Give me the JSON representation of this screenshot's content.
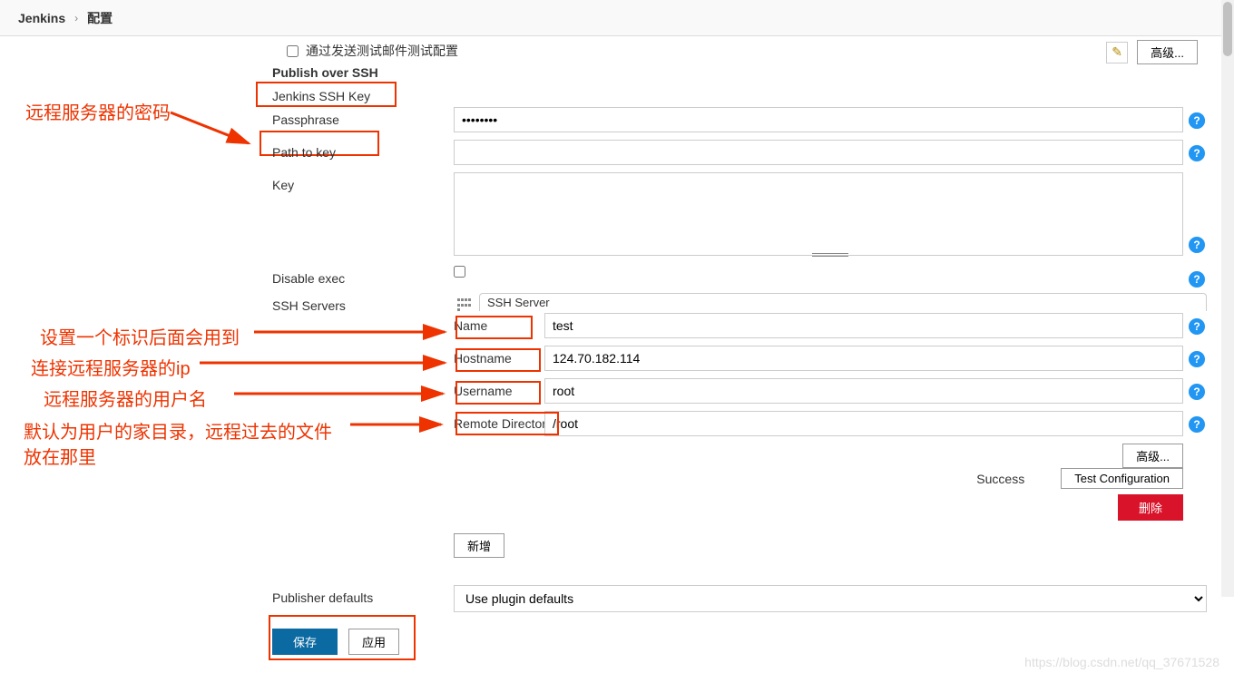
{
  "breadcrumb": {
    "root": "Jenkins",
    "page": "配置"
  },
  "topRight": {
    "advanced": "高级..."
  },
  "annotations": {
    "password": "远程服务器的密码",
    "nameHint": "设置一个标识后面会用到",
    "hostHint": "连接远程服务器的ip",
    "userHint": "远程服务器的用户名",
    "dirHint1": "默认为用户的家目录，远程过去的文件",
    "dirHint2": "放在那里"
  },
  "labels": {
    "testMail": "通过发送测试邮件测试配置",
    "publishSSH": "Publish over SSH",
    "jenkinsKey": "Jenkins SSH Key",
    "passphrase": "Passphrase",
    "pathToKey": "Path to key",
    "key": "Key",
    "disableExec": "Disable exec",
    "sshServers": "SSH Servers",
    "sshServer": "SSH Server",
    "name": "Name",
    "hostname": "Hostname",
    "username": "Username",
    "remoteDir": "Remote Directory",
    "publisherDefaults": "Publisher defaults"
  },
  "values": {
    "passphrase": "••••••••",
    "pathToKey": "",
    "key": "",
    "name": "test",
    "hostname": "124.70.182.114",
    "username": "root",
    "remoteDir": "/root",
    "publisherSelect": "Use plugin defaults"
  },
  "status": {
    "success": "Success"
  },
  "buttons": {
    "advanced": "高级...",
    "testConfig": "Test Configuration",
    "delete": "删除",
    "add": "新增",
    "save": "保存",
    "apply": "应用"
  },
  "watermark": "https://blog.csdn.net/qq_37671528"
}
